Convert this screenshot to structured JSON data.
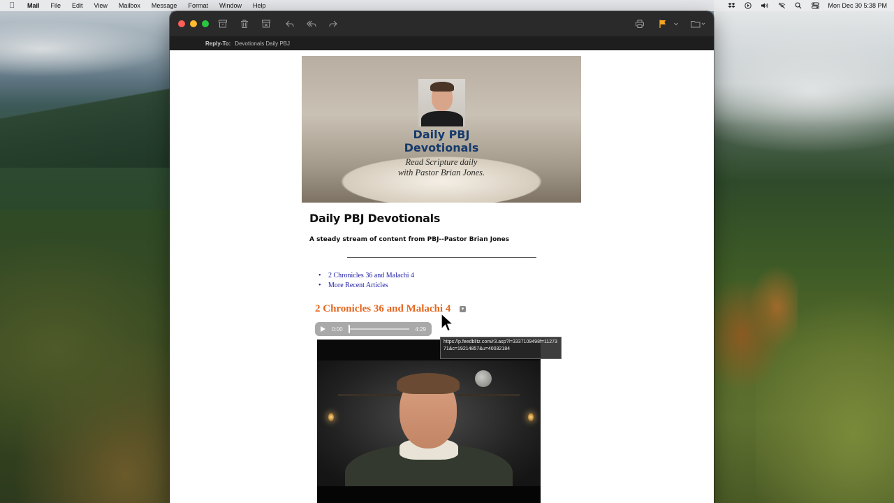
{
  "menubar": {
    "app_name": "Mail",
    "items": [
      "File",
      "Edit",
      "View",
      "Mailbox",
      "Message",
      "Format",
      "Window",
      "Help"
    ],
    "clock": "Mon Dec 30  5:38 PM"
  },
  "window": {
    "reply_to_label": "Reply-To:",
    "reply_to_value": "Devotionals Daily PBJ"
  },
  "email": {
    "banner": {
      "title_line1": "Daily PBJ",
      "title_line2": "Devotionals",
      "subtitle_line1": "Read Scripture daily",
      "subtitle_line2": "with Pastor Brian Jones."
    },
    "title": "Daily PBJ Devotionals",
    "tagline": "A steady stream of content from PBJ--Pastor Brian Jones",
    "links": [
      "2 Chronicles 36 and Malachi 4",
      "More Recent Articles"
    ],
    "article_title": "2 Chronicles 36 and Malachi 4",
    "audio": {
      "current_time": "0:00",
      "duration": "4:29",
      "progress": 0.0
    }
  },
  "tooltip": {
    "text": "https://p.feedblitz.com/r3.asp?l=3337109498f=1127371&c=19214857&u=40032184"
  },
  "colors": {
    "accent_orange": "#e4661f",
    "link_blue": "#1a1aa6",
    "banner_title": "#163a6b"
  }
}
